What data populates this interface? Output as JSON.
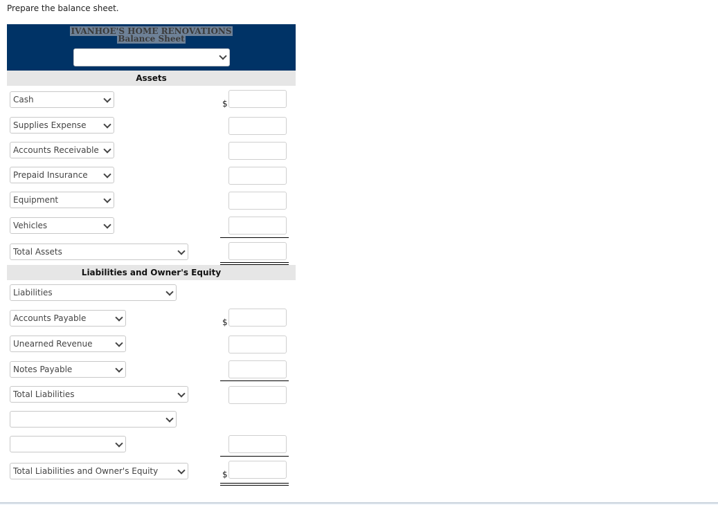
{
  "instruction": "Prepare the balance sheet.",
  "header": {
    "company": "IVANHOE'S HOME RENOVATIONS",
    "statement": "Balance Sheet",
    "date_select_value": ""
  },
  "sections": {
    "assets": "Assets",
    "liabilities_equity": "Liabilities and Owner's Equity"
  },
  "asset_rows": [
    {
      "label": "Cash",
      "amount": "",
      "dollar": "$"
    },
    {
      "label": "Supplies Expense",
      "amount": ""
    },
    {
      "label": "Accounts Receivable",
      "amount": ""
    },
    {
      "label": "Prepaid Insurance",
      "amount": ""
    },
    {
      "label": "Equipment",
      "amount": ""
    },
    {
      "label": "Vehicles",
      "amount": ""
    }
  ],
  "total_assets": {
    "label": "Total Assets",
    "amount": ""
  },
  "liabilities_header": {
    "label": "Liabilities"
  },
  "liability_rows": [
    {
      "label": "Accounts Payable",
      "amount": "",
      "dollar": "$"
    },
    {
      "label": "Unearned Revenue",
      "amount": ""
    },
    {
      "label": "Notes Payable",
      "amount": ""
    }
  ],
  "total_liabilities": {
    "label": "Total Liabilities",
    "amount": ""
  },
  "equity_header": {
    "label": ""
  },
  "equity_row": {
    "label": "",
    "amount": ""
  },
  "total_liab_equity": {
    "label": "Total Liabilities and Owner's Equity",
    "amount": "",
    "dollar": "$"
  }
}
